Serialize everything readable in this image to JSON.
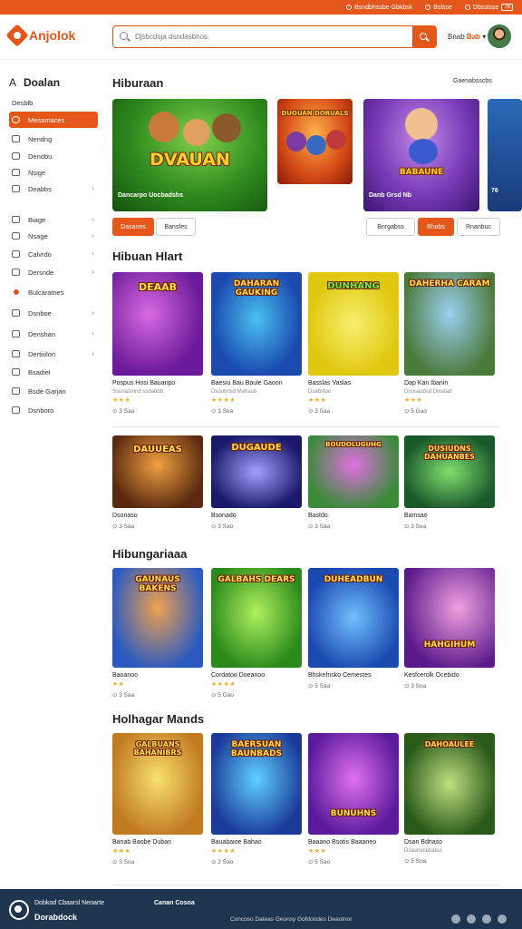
{
  "topbar": {
    "item1": "Bsndbhssbe Gbkbsk",
    "item2": "Bslsse",
    "item3": "Dbsslsse",
    "badge": "76"
  },
  "header": {
    "logo": "Anjolok",
    "search_placeholder": "Djsbcdsja dsndasbhos",
    "user_label": "Bnab",
    "user_name": "Bab"
  },
  "sidebar": {
    "heading_a": "A",
    "heading": "Doalan",
    "items": [
      {
        "label": "Desblb"
      },
      {
        "label": "Mesamaces"
      },
      {
        "label": "Nendng"
      },
      {
        "label": "Denobu"
      },
      {
        "label": "Nsige"
      },
      {
        "label": "Deabbs"
      },
      {
        "label": "Biage"
      },
      {
        "label": "Nsage"
      },
      {
        "label": "Calvrdo"
      },
      {
        "label": "Dersnde"
      },
      {
        "label": "Bulcaratnes"
      },
      {
        "label": "Dsnboe"
      },
      {
        "label": "Denshan"
      },
      {
        "label": "Dertiolon"
      },
      {
        "label": "Bsadiel"
      },
      {
        "label": "Bsde Garjan"
      },
      {
        "label": "Dsnboro"
      }
    ]
  },
  "main": {
    "featured_title": "Hiburaan",
    "see_all": "Gaenabsscbs",
    "banners": [
      {
        "title": "DVAUAN",
        "caption": "Dancarpo Uocbadshs"
      },
      {
        "title": "DUOUAN DORUALS"
      },
      {
        "title": "BABAUNE",
        "caption": "Danb Grsd Nb"
      },
      {
        "caption": "76"
      }
    ],
    "chips_left": [
      "Dasanes",
      "Bansfes"
    ],
    "chips_right": [
      "Bnrgabss",
      "Bhabs",
      "Rnanbuc"
    ],
    "section1_title": "Hibuan Hlart",
    "section2_title": "Hibungariaaa",
    "section3_title": "Holhagar Mands",
    "row1": [
      {
        "title": "DEAAB",
        "name": "Pospus Hosi Bauanpo",
        "sub": "Ssunasmnd ssdabbb",
        "stars": "★★★",
        "meta": "⊙ 3 Saa"
      },
      {
        "title": "DAHARAN GAUKING",
        "name": "Baesiu Bau Baule Gaoon",
        "sub": "Dsoubnsd Mahasb",
        "stars": "★★★★",
        "meta": "⊙ 3 Sea"
      },
      {
        "title": "DUNHANG",
        "name": "Basslas Vaslas",
        "sub": "Dsabstoo",
        "stars": "★★★",
        "meta": "⊙ 3 Saa"
      },
      {
        "title": "DAHERHA CARAM",
        "name": "Dap Kan Ibanin",
        "sub": "Dnosasbsd Dmstad",
        "stars": "★★★",
        "meta": "⊙ 5 Gao"
      }
    ],
    "row2": [
      {
        "title": "DAUUEAS",
        "name": "Dsonaso",
        "meta": "⊙ 3 Saa"
      },
      {
        "title": "DUGAUDE",
        "name": "Bsonado",
        "meta": "⊙ 3 Sao"
      },
      {
        "title": "BOUDOLUGUHG",
        "name": "Bastdo",
        "meta": "⊙ 3 Saa"
      },
      {
        "title": "DUSIUDNS DAHUANBES",
        "name": "Bamsao",
        "meta": "⊙ 3 Sea"
      }
    ],
    "row3": [
      {
        "title": "GAUNAUS BAKENS",
        "name": "Baoanoo",
        "stars": "★★",
        "meta": "⊙ 3 Saa"
      },
      {
        "title": "GALBAHS DEARS",
        "name": "Cordatoo Doeanoo",
        "stars": "★★★★",
        "meta": "⊙ 5 Gao"
      },
      {
        "title": "DUHEADBUN",
        "name": "Bhskefnsko Cemestes",
        "meta": "⊙ 5 Saa"
      },
      {
        "title": "HAHGIHUM",
        "name": "Kesfcerolk Ocebido",
        "meta": "⊙ 3 Soa"
      }
    ],
    "row4": [
      {
        "title": "GALBUANS BAHANIBRS",
        "name": "Banab Baobe Duban",
        "stars": "★★★",
        "meta": "⊙ 3 Soa"
      },
      {
        "title": "BAERSUAN BAUNBADS",
        "name": "Bauabaioe Bahao",
        "stars": "★★★★",
        "meta": "⊙ 2 Sao"
      },
      {
        "title": "BUNUHNS",
        "name": "Baaano Bsotis Baaaneo",
        "stars": "★★★",
        "meta": "⊙ 5 Sao"
      },
      {
        "title": "DAHOAULEE",
        "name": "Dsan Bdnaso",
        "sub": "Dsaonasebalsu",
        "meta": "⊙ 5 Soa"
      }
    ]
  },
  "footer": {
    "line1": "Dobkod Cbaarsl Neoarte",
    "brand": "Dorabdock",
    "col_title": "Canan Cosoa",
    "copyright": "Concoso Dateas Geonsy   Gofdoodes Deaotnor"
  },
  "colors": {
    "accent": "#e4561a",
    "footer": "#1e3550"
  }
}
